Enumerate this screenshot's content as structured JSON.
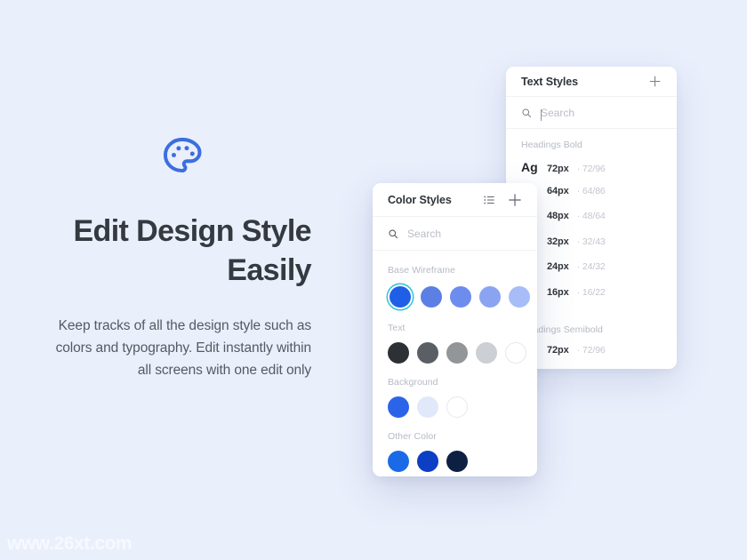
{
  "background_color": "#eaeffc",
  "hero": {
    "icon": "palette-icon",
    "icon_color": "#3b6fe0",
    "title": "Edit Design Style Easily",
    "title_line_1": "Edit Design Style",
    "title_line_2": "Easily",
    "body": "Keep tracks of all the design style such as colors and typography. Edit instantly within all screens with one edit only"
  },
  "text_styles_panel": {
    "title": "Text Styles",
    "add_icon": "plus-icon",
    "search": {
      "icon": "search-icon",
      "value": "",
      "placeholder": "Search"
    },
    "groups": [
      {
        "label": "Headings Bold",
        "items": [
          {
            "sample": "Ag",
            "size": "72px",
            "separator": "·",
            "metrics": "72/96"
          },
          {
            "sample": "",
            "size": "64px",
            "separator": "·",
            "metrics": "64/86"
          },
          {
            "sample": "",
            "size": "48px",
            "separator": "·",
            "metrics": "48/64"
          },
          {
            "sample": "",
            "size": "32px",
            "separator": "·",
            "metrics": "32/43"
          },
          {
            "sample": "",
            "size": "24px",
            "separator": "·",
            "metrics": "24/32"
          },
          {
            "sample": "",
            "size": "16px",
            "separator": "·",
            "metrics": "16/22"
          }
        ]
      },
      {
        "label": "Headings Semibold",
        "items": [
          {
            "sample": "",
            "size": "72px",
            "separator": "·",
            "metrics": "72/96"
          }
        ]
      }
    ]
  },
  "color_styles_panel": {
    "title": "Color Styles",
    "list_icon": "list-view-icon",
    "add_icon": "plus-icon",
    "search": {
      "icon": "search-icon",
      "value": "",
      "placeholder": "Search"
    },
    "groups": [
      {
        "label": "Base Wireframe",
        "selected_index": 0,
        "selection_ring_color": "#2bc5d8",
        "swatches": [
          "#1f5fe8",
          "#5b7fe4",
          "#6c8cee",
          "#8aa4f2",
          "#a8bdf7"
        ]
      },
      {
        "label": "Text",
        "selected_index": -1,
        "swatches": [
          "#2d3034",
          "#5a5f66",
          "#929699",
          "#cccfd3",
          "#ffffff"
        ]
      },
      {
        "label": "Background",
        "selected_index": -1,
        "swatches": [
          "#2b64e8",
          "#e1e8f9",
          "#ffffff"
        ]
      },
      {
        "label": "Other Color",
        "selected_index": -1,
        "swatches": [
          "#1a6ae8",
          "#0d3fc4",
          "#0d2044"
        ]
      }
    ]
  },
  "watermark": {
    "text": "www.26xt.com"
  }
}
